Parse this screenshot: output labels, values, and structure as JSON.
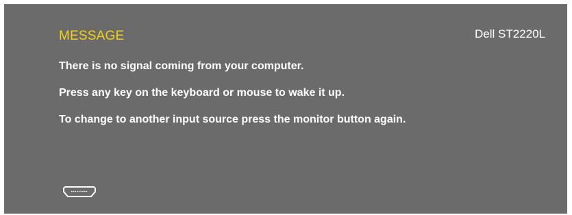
{
  "osd": {
    "title": "MESSAGE",
    "model": "Dell ST2220L",
    "lines": [
      "There is no signal coming from your computer.",
      "Press any key on the keyboard or mouse to wake it up.",
      "To change to another input source press the monitor button again."
    ],
    "input_icon": "hdmi-port-icon",
    "title_color": "#f2d20e",
    "background_color": "#6b6b6b"
  }
}
